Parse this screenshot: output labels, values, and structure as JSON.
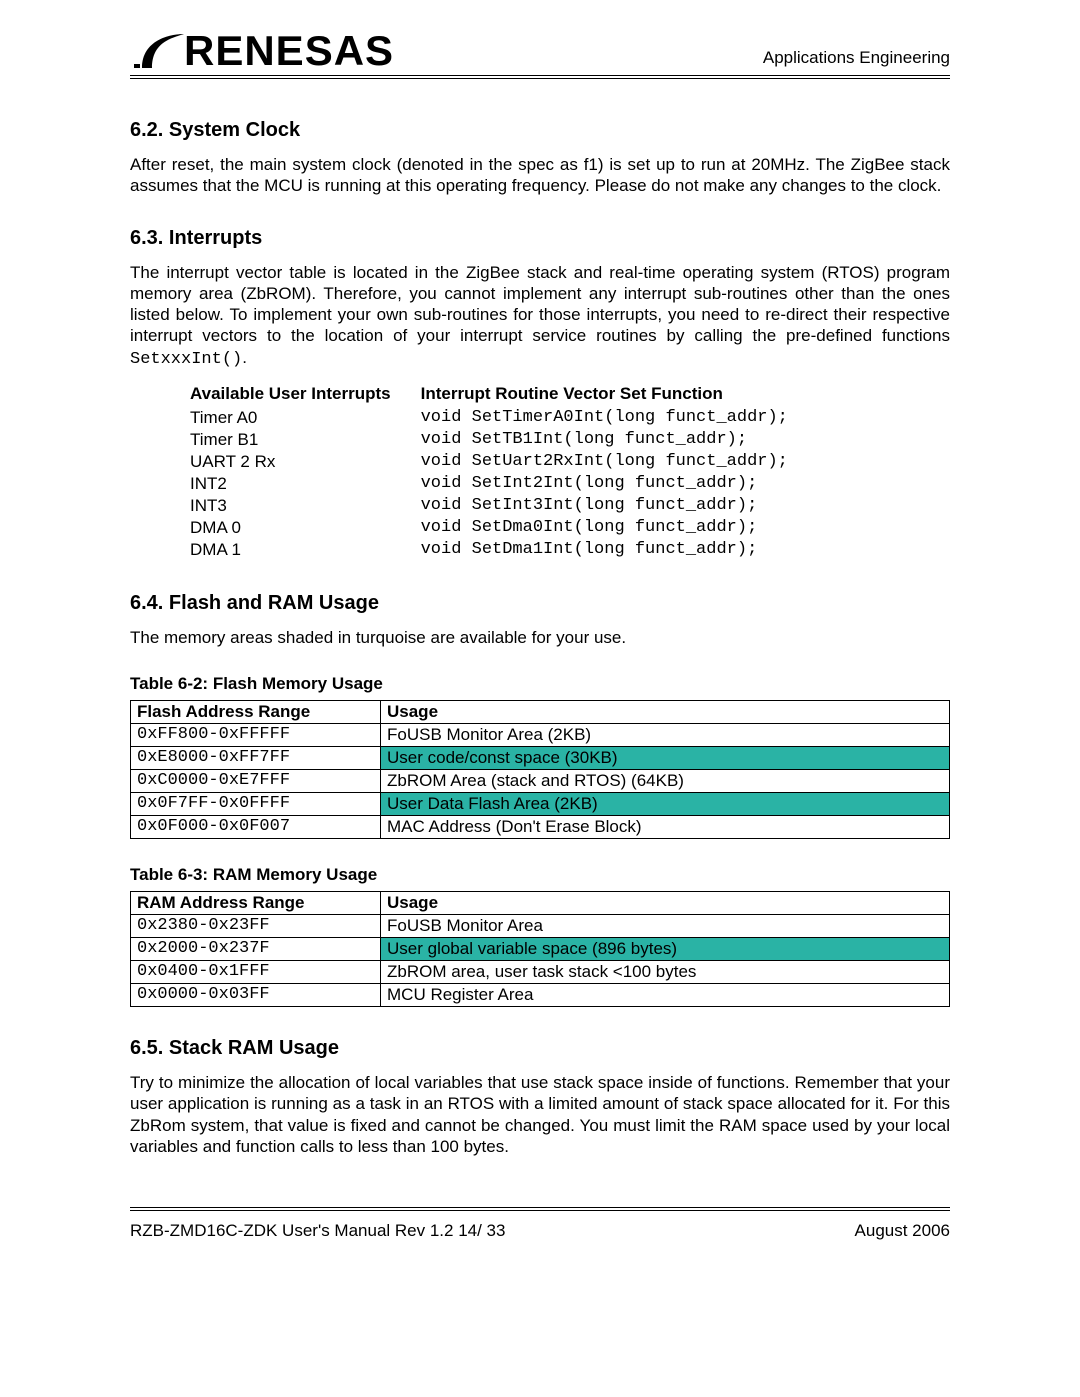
{
  "header": {
    "logo_text": "RENESAS",
    "right_text": "Applications Engineering"
  },
  "sections": {
    "s62": {
      "heading": "6.2. System Clock",
      "para": "After reset, the main system clock (denoted in the spec as f1) is set up to run at 20MHz. The ZigBee stack assumes that the MCU is running at this operating frequency. Please do not make any changes to the clock."
    },
    "s63": {
      "heading": "6.3. Interrupts",
      "para_pre": "The interrupt vector table is located in the ZigBee stack and real-time operating system (RTOS) program memory area (ZbROM). Therefore, you cannot implement any interrupt sub-routines other than the ones listed below. To implement your own sub-routines for those interrupts, you need to re-direct their respective interrupt vectors to the location of your interrupt service routines by calling the pre-defined functions ",
      "para_code": "SetxxxInt()",
      "para_post": ".",
      "col1": "Available User Interrupts",
      "col2": "Interrupt Routine Vector Set Function",
      "rows": [
        {
          "name": "Timer A0",
          "fn": "void SetTimerA0Int(long funct_addr);"
        },
        {
          "name": "Timer B1",
          "fn": "void SetTB1Int(long funct_addr);"
        },
        {
          "name": "UART 2 Rx",
          "fn": "void SetUart2RxInt(long funct_addr);"
        },
        {
          "name": "INT2",
          "fn": "void SetInt2Int(long funct_addr);"
        },
        {
          "name": "INT3",
          "fn": "void SetInt3Int(long funct_addr);"
        },
        {
          "name": "DMA 0",
          "fn": "void SetDma0Int(long funct_addr);"
        },
        {
          "name": "DMA 1",
          "fn": "void SetDma1Int(long funct_addr);"
        }
      ]
    },
    "s64": {
      "heading": "6.4. Flash and RAM Usage",
      "para": "The memory areas shaded in turquoise are available for your use.",
      "flash_caption": "Table 6-2: Flash Memory Usage",
      "flash_col1": "Flash Address Range",
      "flash_col2": "Usage",
      "flash_rows": [
        {
          "addr": "0xFF800-0xFFFFF",
          "usage": "FoUSB Monitor Area (2KB)",
          "hl": false
        },
        {
          "addr": "0xE8000-0xFF7FF",
          "usage": "User code/const space (30KB)",
          "hl": true
        },
        {
          "addr": "0xC0000-0xE7FFF",
          "usage": "ZbROM Area (stack and RTOS) (64KB)",
          "hl": false
        },
        {
          "addr": "0x0F7FF-0x0FFFF",
          "usage": "User Data Flash Area (2KB)",
          "hl": true
        },
        {
          "addr": "0x0F000-0x0F007",
          "usage": "MAC Address (Don't Erase Block)",
          "hl": false
        }
      ],
      "ram_caption": "Table 6-3: RAM Memory Usage",
      "ram_col1": "RAM Address Range",
      "ram_col2": "Usage",
      "ram_rows": [
        {
          "addr": "0x2380-0x23FF",
          "usage": "FoUSB Monitor Area",
          "hl": false
        },
        {
          "addr": "0x2000-0x237F",
          "usage": "User global variable space (896 bytes)",
          "hl": true
        },
        {
          "addr": "0x0400-0x1FFF",
          "usage": "ZbROM area, user task stack <100 bytes",
          "hl": false
        },
        {
          "addr": "0x0000-0x03FF",
          "usage": "MCU Register Area",
          "hl": false
        }
      ]
    },
    "s65": {
      "heading": "6.5. Stack RAM Usage",
      "para": "Try to minimize the allocation of local variables that use stack space inside of functions. Remember that your user application is running as a task in an RTOS with a limited amount of stack space allocated for it. For this ZbRom system, that value is fixed and cannot be changed. You must limit the RAM space used by your local variables and function calls to less than 100 bytes."
    }
  },
  "footer": {
    "left": "RZB-ZMD16C-ZDK User's Manual Rev 1.2    14/ 33",
    "right": "August 2006"
  }
}
